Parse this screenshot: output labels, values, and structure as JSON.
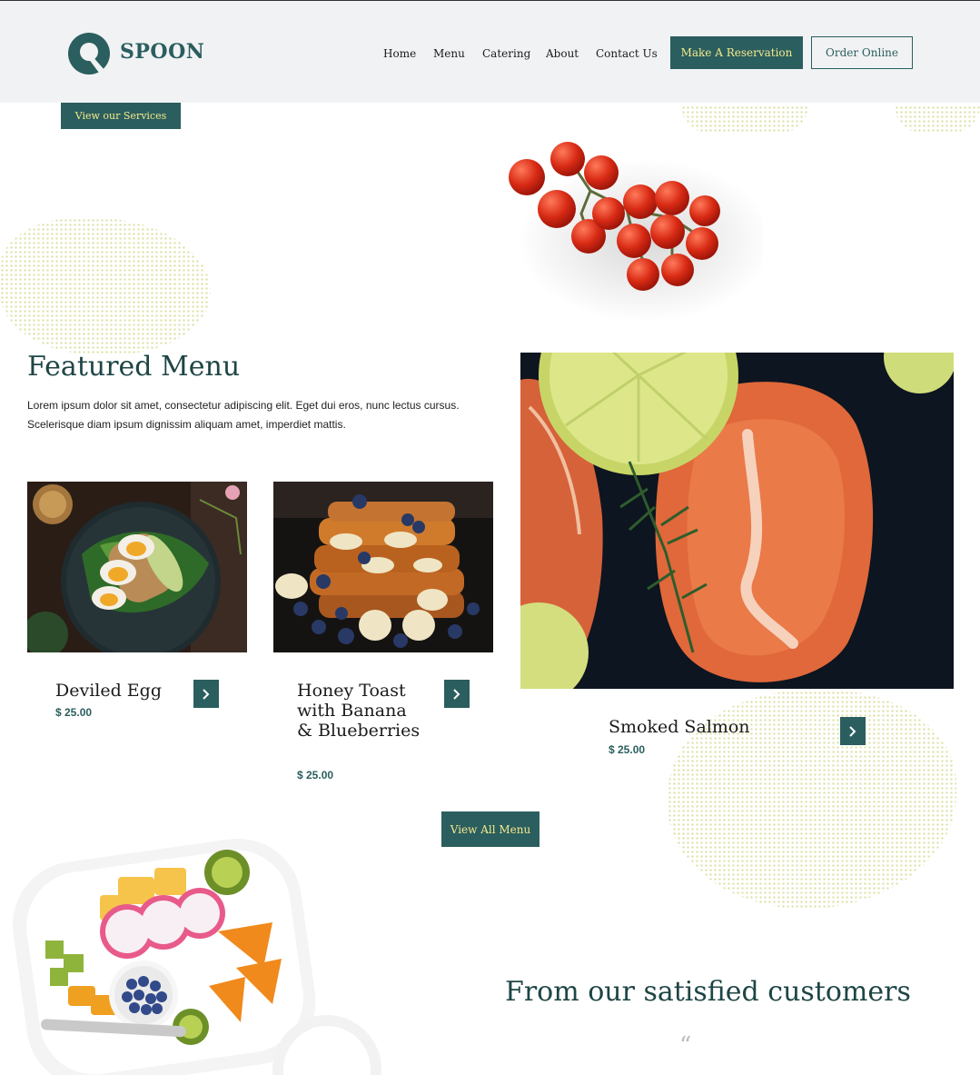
{
  "brand": {
    "name": "SPOON",
    "color": "#2b5e5e",
    "accent": "#f4e98d"
  },
  "nav": {
    "items": [
      "Home",
      "Menu",
      "Catering",
      "About",
      "Contact Us"
    ],
    "reserve_label": "Make A Reservation",
    "order_label": "Order Online"
  },
  "hero": {
    "services_label": "View our Services"
  },
  "featured": {
    "title": "Featured Menu",
    "description": "Lorem ipsum dolor sit amet, consectetur adipiscing elit. Eget dui eros, nunc lectus cursus. Scelerisque diam ipsum dignissim aliquam amet, imperdiet mattis.",
    "dishes": [
      {
        "name": "Deviled Egg",
        "price": "$ 25.00"
      },
      {
        "name": "Honey Toast with Banana & Blueberries",
        "price": "$ 25.00"
      },
      {
        "name": "Smoked Salmon",
        "price": "$ 25.00"
      }
    ],
    "view_all_label": "View All Menu"
  },
  "testimonials": {
    "title": "From our satisfied customers",
    "quote_mark": "“"
  }
}
